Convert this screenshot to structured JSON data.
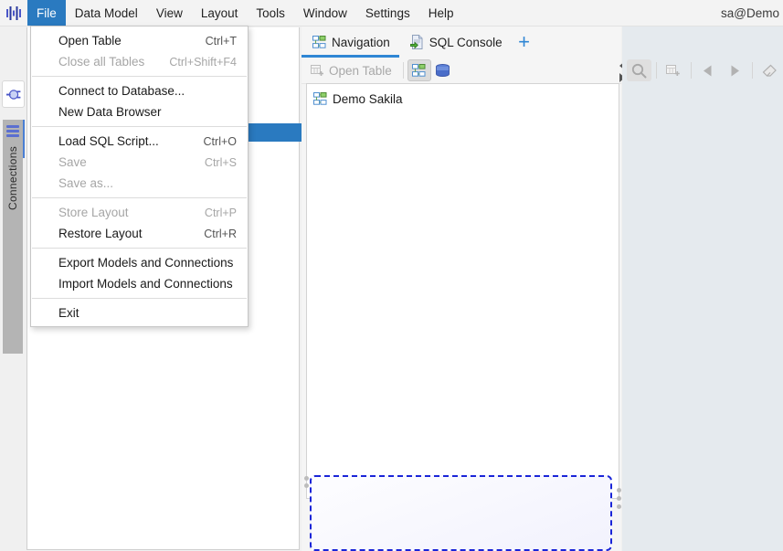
{
  "window": {
    "logo_icon": "app-logo-icon",
    "user_label": "sa@Demo"
  },
  "menubar": {
    "items": [
      {
        "label": "File",
        "active": true
      },
      {
        "label": "Data Model",
        "active": false
      },
      {
        "label": "View",
        "active": false
      },
      {
        "label": "Layout",
        "active": false
      },
      {
        "label": "Tools",
        "active": false
      },
      {
        "label": "Window",
        "active": false
      },
      {
        "label": "Settings",
        "active": false
      },
      {
        "label": "Help",
        "active": false
      }
    ]
  },
  "file_menu": {
    "groups": [
      {
        "items": [
          {
            "label": "Open Table",
            "accel": "Ctrl+T",
            "disabled": false
          },
          {
            "label": "Close all Tables",
            "accel": "Ctrl+Shift+F4",
            "disabled": true
          }
        ]
      },
      {
        "items": [
          {
            "label": "Connect to Database...",
            "accel": "",
            "disabled": false
          },
          {
            "label": "New Data Browser",
            "accel": "",
            "disabled": false
          }
        ]
      },
      {
        "items": [
          {
            "label": "Load SQL Script...",
            "accel": "Ctrl+O",
            "disabled": false
          },
          {
            "label": "Save",
            "accel": "Ctrl+S",
            "disabled": true
          },
          {
            "label": "Save as...",
            "accel": "",
            "disabled": true
          }
        ]
      },
      {
        "items": [
          {
            "label": "Store Layout",
            "accel": "Ctrl+P",
            "disabled": true
          },
          {
            "label": "Restore Layout",
            "accel": "Ctrl+R",
            "disabled": false
          }
        ]
      },
      {
        "items": [
          {
            "label": "Export Models and Connections",
            "accel": "",
            "disabled": false
          },
          {
            "label": "Import Models and Connections",
            "accel": "",
            "disabled": false
          }
        ]
      },
      {
        "items": [
          {
            "label": "Exit",
            "accel": "",
            "disabled": false
          }
        ]
      }
    ]
  },
  "left_rail": {
    "plug_icon": "plug-connect-icon",
    "connections_icon": "list-bars-icon",
    "connections_label": "Connections"
  },
  "tabs": [
    {
      "label": "Navigation",
      "icon": "navigation-graph-icon",
      "selected": true
    },
    {
      "label": "SQL Console",
      "icon": "sql-console-icon",
      "selected": false
    }
  ],
  "tab_add": {
    "label": "+",
    "icon": "plus-icon"
  },
  "toolbar": {
    "open_table_label": "Open Table",
    "open_table_icon": "table-open-icon",
    "open_table_disabled": true,
    "buttons": [
      {
        "icon": "navigation-graph-icon",
        "pressed": true
      },
      {
        "icon": "database-icon",
        "pressed": false
      }
    ],
    "scroll_left_icon": "triangle-left-icon",
    "scroll_right_icon": "triangle-right-icon"
  },
  "right_toolbar": {
    "buttons": [
      {
        "icon": "search-icon",
        "pressed": true
      },
      {
        "icon": "table-add-icon",
        "pressed": false
      },
      {
        "icon": "arrow-back-icon",
        "pressed": false
      },
      {
        "icon": "arrow-forward-icon",
        "pressed": false
      },
      {
        "icon": "eraser-icon",
        "pressed": false
      }
    ]
  },
  "tree": {
    "nodes": [
      {
        "label": "Demo Sakila",
        "icon": "navigation-graph-icon"
      }
    ]
  },
  "dropzone": {
    "label": ""
  },
  "colors": {
    "accent_blue": "#2a7ac0",
    "tab_underline": "#2f86d4",
    "dropzone_border": "#1a25d8",
    "rail_tab_bg": "#b4b4b4",
    "right_panel_bg": "#e5eaee"
  }
}
